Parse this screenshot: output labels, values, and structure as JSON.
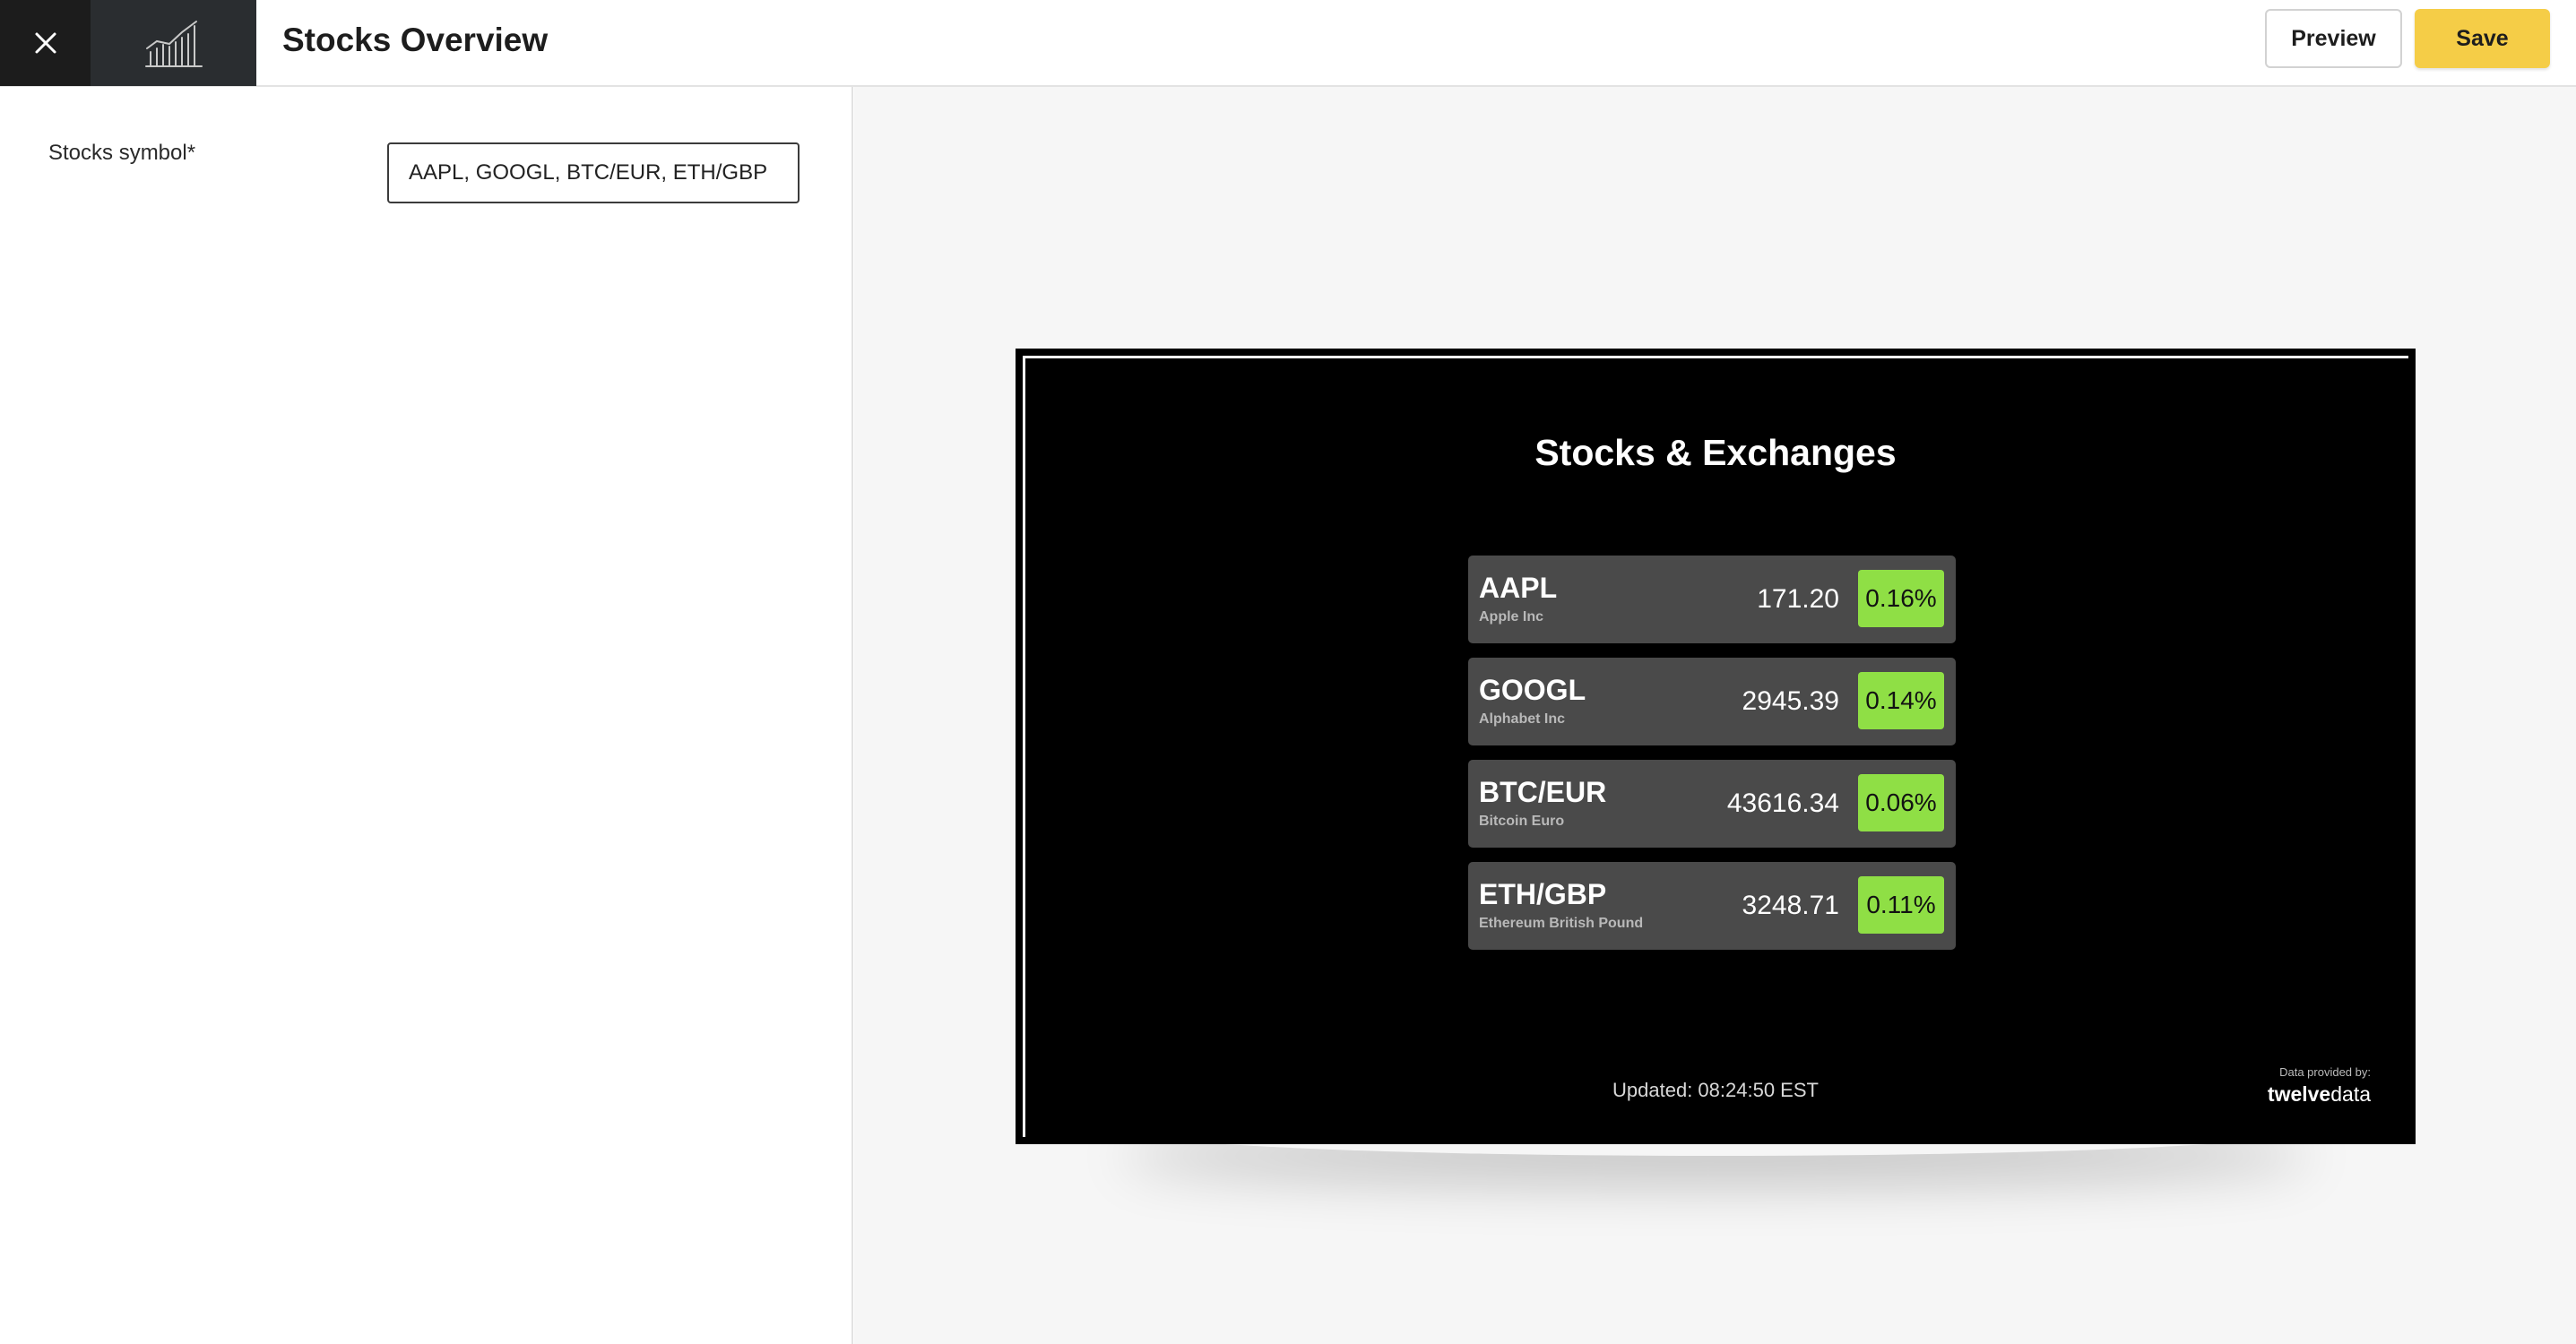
{
  "header": {
    "title": "Stocks Overview",
    "preview_label": "Preview",
    "save_label": "Save"
  },
  "settings": {
    "symbol_label": "Stocks symbol*",
    "symbol_value": "AAPL, GOOGL, BTC/EUR, ETH/GBP"
  },
  "widget": {
    "title": "Stocks & Exchanges",
    "rows": [
      {
        "symbol": "AAPL",
        "name": "Apple Inc",
        "price": "171.20",
        "change": "0.16%"
      },
      {
        "symbol": "GOOGL",
        "name": "Alphabet Inc",
        "price": "2945.39",
        "change": "0.14%"
      },
      {
        "symbol": "BTC/EUR",
        "name": "Bitcoin Euro",
        "price": "43616.34",
        "change": "0.06%"
      },
      {
        "symbol": "ETH/GBP",
        "name": "Ethereum British Pound",
        "price": "3248.71",
        "change": "0.11%"
      }
    ],
    "updated": "Updated: 08:24:50 EST",
    "credit_label": "Data provided by:",
    "credit_brand_bold": "twelve",
    "credit_brand_rest": "data"
  },
  "colors": {
    "accent_save": "#f5cd47",
    "change_positive": "#8fdf45",
    "row_bg": "#4a4a4a",
    "screen_bg": "#000000"
  },
  "icons": {
    "close": "close-icon",
    "app": "line-chart-icon"
  }
}
